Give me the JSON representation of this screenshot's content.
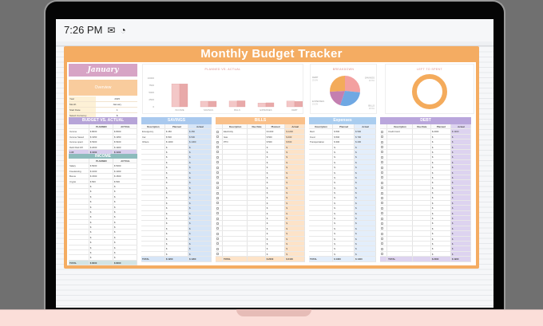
{
  "status_bar": {
    "time": "7:26 PM",
    "icons": [
      "gmail-icon",
      "whatsapp-icon"
    ]
  },
  "title": "Monthly Budget Tracker",
  "month": "January",
  "overview": {
    "title": "Overview",
    "rows": [
      [
        "Year",
        "2025"
      ],
      [
        "Month",
        "January"
      ],
      [
        "Start Date",
        "1"
      ],
      [
        "Select Currency",
        "$"
      ]
    ]
  },
  "currency": "$",
  "colors": {
    "frame": "#f4ac62",
    "savings": "#a9c9ee",
    "bills": "#f9c08a",
    "expenses": "#aacdef",
    "debt": "#b9a6dc",
    "budget": "#b6a4d8",
    "income": "#8dbcbc",
    "pie": [
      "#f3a0a0",
      "#6fa8e3",
      "#c47fb0",
      "#f3ab5a"
    ],
    "bar_planned": "#f3c7c7",
    "bar_actual": "#e8a9a9"
  },
  "chart_data": [
    {
      "type": "bar",
      "title": "PLANNED VS. ACTUAL",
      "categories": [
        "INCOME",
        "SAVINGS",
        "BILLS",
        "EXPENSES",
        "DEBT"
      ],
      "series": [
        {
          "name": "Planned",
          "values": [
            8000,
            1950,
            2000,
            1300,
            2000
          ]
        },
        {
          "name": "Actual",
          "values": [
            8000,
            1950,
            2100,
            1400,
            1900
          ]
        }
      ],
      "yticks": [
        "0",
        "2500",
        "5000",
        "7500",
        "10000"
      ],
      "ylim": [
        0,
        10000
      ]
    },
    {
      "type": "pie",
      "title": "BREAKDOWN",
      "labels": [
        "SAVINGS",
        "BILLS",
        "EXPENSES",
        "DEBT"
      ],
      "values": [
        1950,
        2100,
        1400,
        1900
      ],
      "pct": [
        "26.5%",
        "28.5%",
        "19.0%",
        "25.8%"
      ]
    },
    {
      "type": "donut",
      "title": "LEFT TO SPENT",
      "value_fraction": 1.0
    }
  ],
  "budget": {
    "title": "BUDGET VS. ACTUAL",
    "cols": [
      "",
      "PLANNED",
      "ACTUAL"
    ],
    "rows": [
      [
        "Income",
        "$ 8000",
        "$ 8000"
      ],
      [
        "Income Saved",
        "$ 1950",
        "$ 1950"
      ],
      [
        "Income spent",
        "$ 5300",
        "$ 5400"
      ],
      [
        "Debt Paid Off",
        "$ 2000",
        "$ 1900"
      ]
    ],
    "total": [
      "LUF",
      "$ 1000",
      "$ 1100"
    ]
  },
  "income": {
    "title": "INCOME",
    "cols": [
      "",
      "PLANNED",
      "ACTUAL"
    ],
    "rows": [
      [
        "Salary",
        "$ 5000",
        "$ 5000"
      ],
      [
        "Freelancing",
        "$ 1000",
        "$ 1000"
      ],
      [
        "Bonus",
        "$ 1500",
        "$ 1500"
      ],
      [
        "Crypto",
        "$ 500",
        "$ 500"
      ]
    ],
    "total": [
      "TOTAL",
      "$ 8000",
      "$ 8000"
    ]
  },
  "savings": {
    "title": "SAVINGS",
    "cols": [
      "Description",
      "Planned",
      "Actual"
    ],
    "rows": [
      [
        "Emergency",
        "$ 450",
        "$ 450"
      ],
      [
        "Car",
        "$ 500",
        "$ 500"
      ],
      [
        "Others",
        "$ 1000",
        "$ 1000"
      ]
    ],
    "total": [
      "TOTAL",
      "$ 1950",
      "$ 1950"
    ]
  },
  "bills": {
    "title": "BILLS",
    "cols": [
      "",
      "Description",
      "Due Date",
      "Planned",
      "Actual"
    ],
    "rows": [
      [
        "",
        "Electricity",
        "",
        "$ 1000",
        "$ 1200"
      ],
      [
        "",
        "Gas",
        "",
        "$ 500",
        "$ 400"
      ],
      [
        "",
        "PTO",
        "",
        "$ 500",
        "$ 500"
      ]
    ],
    "total": [
      "",
      "TOTAL",
      "",
      "$ 2000",
      "$ 2100"
    ]
  },
  "expenses": {
    "title": "Expenses",
    "cols": [
      "Description",
      "Planned",
      "Actual"
    ],
    "rows": [
      [
        "Rent",
        "$ 500",
        "$ 500"
      ],
      [
        "Food",
        "$ 500",
        "$ 700"
      ],
      [
        "Transportation",
        "$ 300",
        "$ 200"
      ]
    ],
    "total": [
      "TOTAL",
      "$ 1300",
      "$ 1400"
    ]
  },
  "debt": {
    "title": "DEBT",
    "cols": [
      "",
      "Description",
      "Due Date",
      "Planned",
      "Actual"
    ],
    "rows": [
      [
        "",
        "Credit Card",
        "",
        "$ 2000",
        "$ 1900"
      ]
    ],
    "total": [
      "",
      "TOTAL",
      "",
      "$ 2000",
      "$ 1900"
    ]
  }
}
